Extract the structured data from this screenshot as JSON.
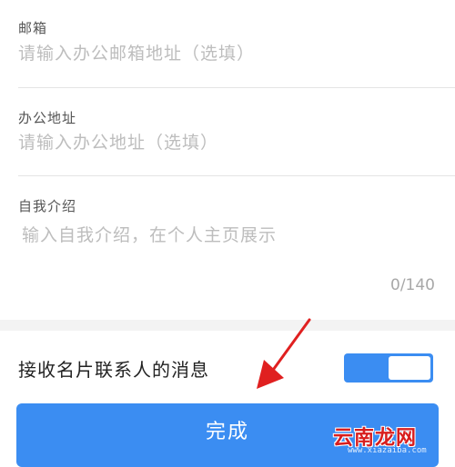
{
  "form": {
    "email": {
      "label": "邮箱",
      "placeholder": "请输入办公邮箱地址（选填）"
    },
    "office_address": {
      "label": "办公地址",
      "placeholder": "请输入办公地址（选填）"
    },
    "intro": {
      "label": "自我介绍",
      "placeholder": "输入自我介绍，在个人主页展示",
      "counter": "0/140"
    }
  },
  "toggle": {
    "label": "接收名片联系人的消息",
    "on": true
  },
  "submit_label": "完成",
  "watermark": {
    "text": "云南龙网",
    "url": "www.xiazaiba.com"
  },
  "colors": {
    "accent": "#3b8df2",
    "arrow": "#e02020",
    "watermark": "#d81e1e"
  }
}
